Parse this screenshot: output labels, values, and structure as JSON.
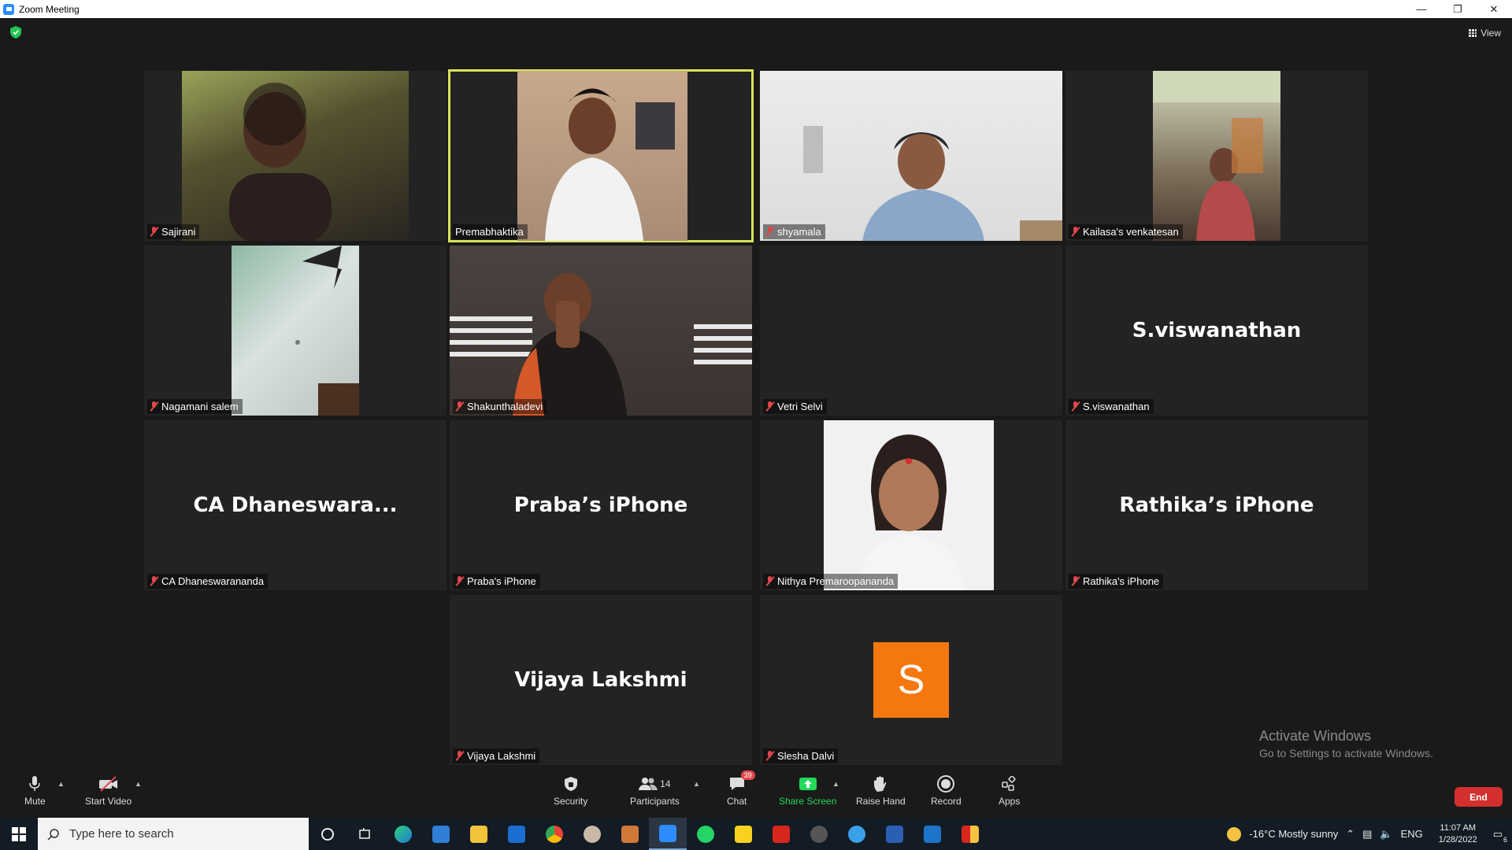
{
  "window": {
    "title": "Zoom Meeting"
  },
  "top_bar": {
    "view_label": "View"
  },
  "tiles": [
    {
      "name": "Sajirani",
      "big": ""
    },
    {
      "name": "Premabhaktika",
      "big": ""
    },
    {
      "name": "shyamala",
      "big": ""
    },
    {
      "name": "Kailasa's venkatesan",
      "big": ""
    },
    {
      "name": "Nagamani salem",
      "big": ""
    },
    {
      "name": "Shakunthaladevi",
      "big": ""
    },
    {
      "name": "Vetri Selvi",
      "big": ""
    },
    {
      "name": "S.viswanathan",
      "big": "S.viswanathan"
    },
    {
      "name": "CA Dhaneswarananda",
      "big": "CA  Dhaneswara..."
    },
    {
      "name": "Praba's iPhone",
      "big": "Praba’s iPhone"
    },
    {
      "name": "Nithya Premaroopananda",
      "big": ""
    },
    {
      "name": "Rathika's iPhone",
      "big": "Rathika’s iPhone"
    },
    {
      "name": "Vijaya Lakshmi",
      "big": "Vijaya Lakshmi"
    },
    {
      "name": "Slesha Dalvi",
      "big": "",
      "avatar_letter": "S"
    }
  ],
  "watermark": {
    "line1": "Activate Windows",
    "line2": "Go to Settings to activate Windows."
  },
  "toolbar": {
    "mute": "Mute",
    "start_video": "Start Video",
    "security": "Security",
    "participants": "Participants",
    "participants_count": "14",
    "chat": "Chat",
    "chat_badge": "39",
    "share_screen": "Share Screen",
    "raise_hand": "Raise Hand",
    "record": "Record",
    "apps": "Apps",
    "end": "End"
  },
  "taskbar": {
    "search_placeholder": "Type here to search",
    "weather": "-16°C  Mostly sunny",
    "language": "ENG",
    "time": "11:07 AM",
    "date": "1/28/2022",
    "notification_count": "6"
  },
  "colors": {
    "accent_active": "#d8e35a",
    "share_green": "#23d959",
    "end_red": "#d32f2f",
    "avatar_orange": "#f5780f",
    "muted_red": "#e0474c"
  }
}
